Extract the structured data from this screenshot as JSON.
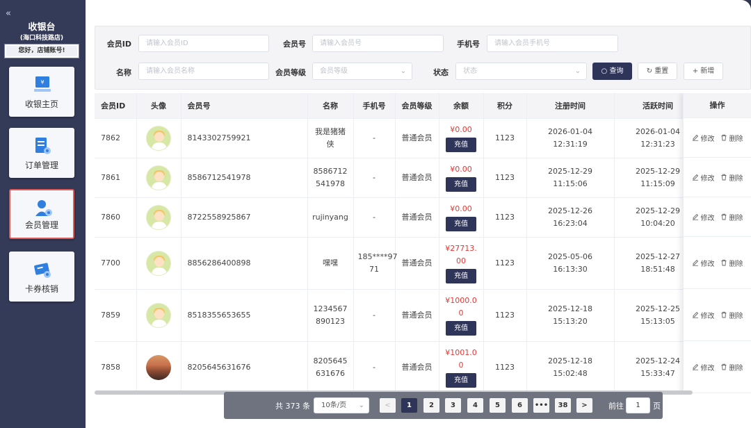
{
  "sidebar": {
    "title": "收银台",
    "store": "(海口科技路店)",
    "greeting": "您好，店铺账号!",
    "collapse_icon": "«",
    "items": [
      {
        "label": "收银主页",
        "icon": "cashier-icon"
      },
      {
        "label": "订单管理",
        "icon": "order-icon"
      },
      {
        "label": "会员管理",
        "icon": "member-icon",
        "active": true
      },
      {
        "label": "卡券核销",
        "icon": "coupon-icon"
      }
    ]
  },
  "filter": {
    "member_id_label": "会员ID",
    "member_id_placeholder": "请输入会员ID",
    "member_no_label": "会员号",
    "member_no_placeholder": "请输入会员号",
    "phone_label": "手机号",
    "phone_placeholder": "请输入会员手机号",
    "name_label": "名称",
    "name_placeholder": "请输入会员名称",
    "level_label": "会员等级",
    "level_placeholder": "会员等级",
    "status_label": "状态",
    "status_placeholder": "状态",
    "search_label": "查询",
    "reset_label": "重置",
    "add_label": "新增"
  },
  "table": {
    "headers": {
      "id": "会员ID",
      "avatar": "头像",
      "member_no": "会员号",
      "name": "名称",
      "phone": "手机号",
      "level": "会员等级",
      "balance": "余额",
      "points": "积分",
      "reg_time": "注册时间",
      "active_time": "活跃时间",
      "ops": "操作"
    },
    "recharge_label": "充值",
    "edit_label": "修改",
    "delete_label": "删除",
    "rows": [
      {
        "id": "7862",
        "member_no": "8143302759921",
        "name_l1": "我是猪猪",
        "name_l2": "侠",
        "phone_l1": "-",
        "phone_l2": "",
        "level": "普通会员",
        "bal_l1": "¥0.00",
        "bal_l2": "",
        "points": "1123",
        "reg": "2026-01-04 12:31:19",
        "act": "2026-01-04 12:31:23",
        "status_on": true
      },
      {
        "id": "7861",
        "member_no": "8586712541978",
        "name_l1": "8586712",
        "name_l2": "541978",
        "phone_l1": "-",
        "phone_l2": "",
        "level": "普通会员",
        "bal_l1": "¥0.00",
        "bal_l2": "",
        "points": "1123",
        "reg": "2025-12-29 11:15:06",
        "act": "2025-12-29 11:15:09",
        "status_on": true
      },
      {
        "id": "7860",
        "member_no": "8722558925867",
        "name_l1": "rujinyang",
        "name_l2": "",
        "phone_l1": "-",
        "phone_l2": "",
        "level": "普通会员",
        "bal_l1": "¥0.00",
        "bal_l2": "",
        "points": "1123",
        "reg": "2025-12-26 16:23:04",
        "act": "2025-12-29 10:04:20",
        "status_on": false
      },
      {
        "id": "7700",
        "member_no": "8856286400898",
        "name_l1": "嘿嘿",
        "name_l2": "",
        "phone_l1": "185****97",
        "phone_l2": "71",
        "level": "普通会员",
        "bal_l1": "¥27713.",
        "bal_l2": "00",
        "points": "1123",
        "reg": "2025-05-06 16:13:30",
        "act": "2025-12-27 18:51:48",
        "status_on": true
      },
      {
        "id": "7859",
        "member_no": "8518355653655",
        "name_l1": "1234567",
        "name_l2": "890123",
        "phone_l1": "-",
        "phone_l2": "",
        "level": "普通会员",
        "bal_l1": "¥1000.0",
        "bal_l2": "0",
        "points": "1123",
        "reg": "2025-12-18 15:13:20",
        "act": "2025-12-25 15:13:05",
        "status_on": true
      },
      {
        "id": "7858",
        "member_no": "8205645631676",
        "name_l1": "8205645",
        "name_l2": "631676",
        "phone_l1": "-",
        "phone_l2": "",
        "level": "普通会员",
        "bal_l1": "¥1001.0",
        "bal_l2": "0",
        "points": "1123",
        "reg": "2025-12-18 15:02:48",
        "act": "2025-12-24 15:33:47",
        "status_on": true,
        "photo": true
      }
    ]
  },
  "pager": {
    "total": "共 373 条",
    "page_size": "10条/页",
    "prev": "<",
    "next": ">",
    "pages": [
      "1",
      "2",
      "3",
      "4",
      "5",
      "6",
      "•••",
      "38"
    ],
    "goto_label": "前往",
    "goto_value": "1",
    "page_unit": "页"
  }
}
